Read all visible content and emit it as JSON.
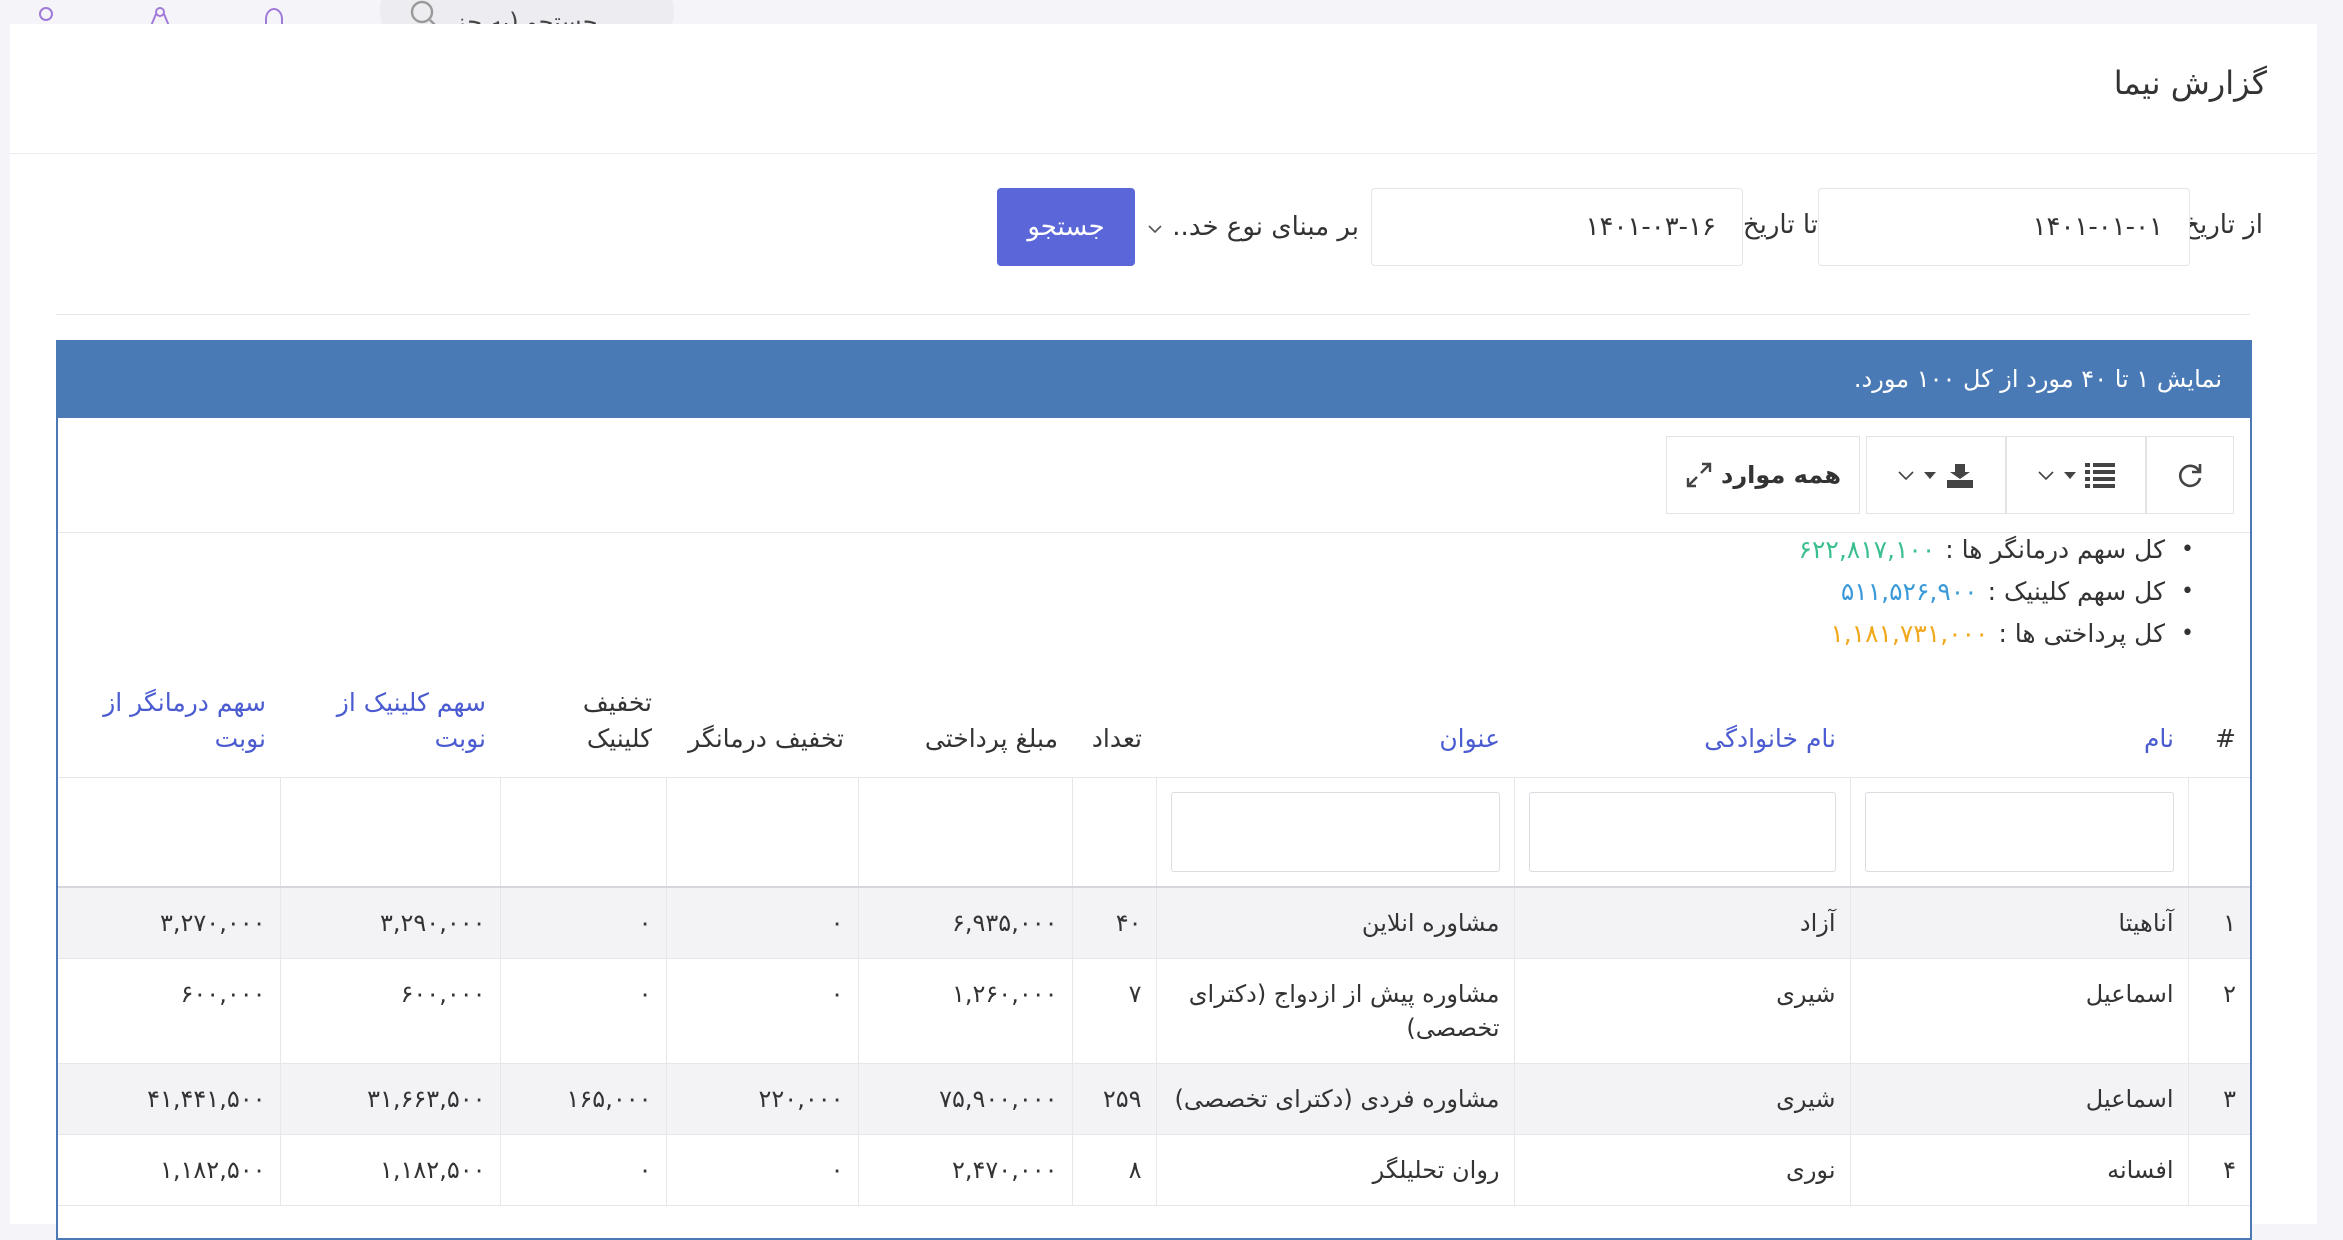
{
  "topbar": {
    "search_placeholder": "جستجو (به جز",
    "icons": [
      "search-icon",
      "bell-icon",
      "share-icon",
      "user-icon"
    ]
  },
  "page": {
    "title": "گزارش نیما"
  },
  "filters": {
    "from_label": "از تاریخ",
    "from_value": "۱۴۰۱-۰۱-۰۱",
    "to_label": "تا تاریخ",
    "to_value": "۱۴۰۱-۰۳-۱۶",
    "basis_value": "بر مبنای نوع خد..",
    "search_button": "جستجو"
  },
  "panel": {
    "heading": "نمایش ۱ تا ۴۰ مورد از کل ۱۰۰ مورد."
  },
  "toolbar": {
    "all_items_label": "همه موارد"
  },
  "summary": [
    {
      "label": "کل سهم درمانگر ها :",
      "value": "۶۲۲,۸۱۷,۱۰۰",
      "color": "#3bbf8f"
    },
    {
      "label": "کل سهم کلینیک :",
      "value": "۵۱۱,۵۲۶,۹۰۰",
      "color": "#3a9ad9"
    },
    {
      "label": "کل پرداختی ها :",
      "value": "۱,۱۸۱,۷۳۱,۰۰۰",
      "color": "#f0a81c"
    }
  ],
  "columns": [
    {
      "label": "#",
      "sortable": false
    },
    {
      "label": "نام",
      "sortable": true
    },
    {
      "label": "نام خانوادگی",
      "sortable": true
    },
    {
      "label": "عنوان",
      "sortable": true
    },
    {
      "label": "تعداد",
      "sortable": false
    },
    {
      "label": "مبلغ پرداختی",
      "sortable": false
    },
    {
      "label": "تخفیف درمانگر",
      "sortable": false
    },
    {
      "label": "تخفیف کلینیک",
      "sortable": false
    },
    {
      "label": "سهم کلینیک از نوبت",
      "sortable": true
    },
    {
      "label": "سهم درمانگر از نوبت",
      "sortable": true
    }
  ],
  "rows": [
    [
      "۱",
      "آناهیتا",
      "آزاد",
      "مشاوره انلاین",
      "۴۰",
      "۶,۹۳۵,۰۰۰",
      "۰",
      "۰",
      "۳,۲۹۰,۰۰۰",
      "۳,۲۷۰,۰۰۰"
    ],
    [
      "۲",
      "اسماعیل",
      "شیری",
      "مشاوره پیش از ازدواج (دکترای تخصصی)",
      "۷",
      "۱,۲۶۰,۰۰۰",
      "۰",
      "۰",
      "۶۰۰,۰۰۰",
      "۶۰۰,۰۰۰"
    ],
    [
      "۳",
      "اسماعیل",
      "شیری",
      "مشاوره فردی (دکترای تخصصی)",
      "۲۵۹",
      "۷۵,۹۰۰,۰۰۰",
      "۲۲۰,۰۰۰",
      "۱۶۵,۰۰۰",
      "۳۱,۶۶۳,۵۰۰",
      "۴۱,۴۴۱,۵۰۰"
    ],
    [
      "۴",
      "افسانه",
      "نوری",
      "روان تحلیلگر",
      "۸",
      "۲,۴۷۰,۰۰۰",
      "۰",
      "۰",
      "۱,۱۸۲,۵۰۰",
      "۱,۱۸۲,۵۰۰"
    ]
  ]
}
